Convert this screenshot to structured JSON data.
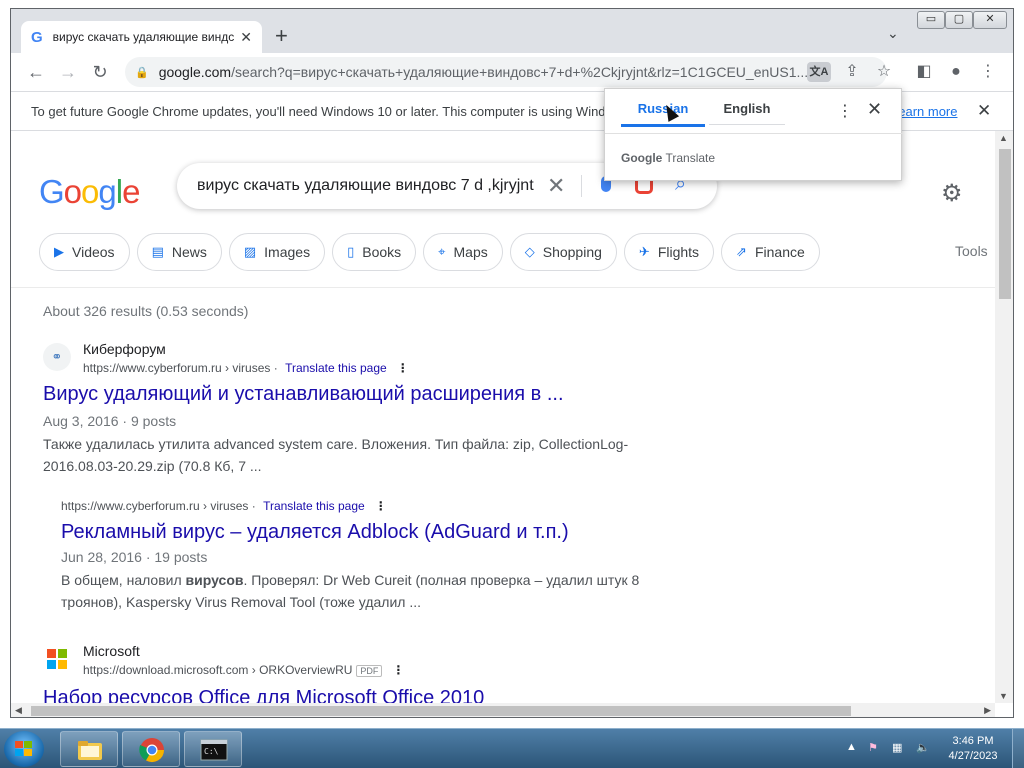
{
  "browser": {
    "tab_title": "вирус скачать удаляющие виндс",
    "tab_close": "✕",
    "new_tab": "+",
    "url_domain": "google.com",
    "url_path": "/search?q=вирус+скачать+удаляющие+виндовс+7+d+%2Ckjryjnt&rlz=1C1GCEU_enUS1...",
    "window_controls": [
      "▭",
      "▢",
      "✕"
    ]
  },
  "infobar": {
    "message": "To get future Google Chrome updates, you'll need Windows 10 or later. This computer is using Windows 7.",
    "learn_more": "Learn more"
  },
  "search": {
    "logo": [
      "G",
      "o",
      "o",
      "g",
      "l",
      "e"
    ],
    "query": "вирус скачать удаляющие виндовс 7 d ,kjryjnt",
    "chips": [
      {
        "icon": "▶",
        "label": "Videos"
      },
      {
        "icon": "▤",
        "label": "News"
      },
      {
        "icon": "▨",
        "label": "Images"
      },
      {
        "icon": "▯",
        "label": "Books"
      },
      {
        "icon": "⌖",
        "label": "Maps"
      },
      {
        "icon": "◇",
        "label": "Shopping"
      },
      {
        "icon": "✈",
        "label": "Flights"
      },
      {
        "icon": "⇗",
        "label": "Finance"
      }
    ],
    "tools": "Tools",
    "stats": "About 326 results (0.53 seconds)"
  },
  "results": [
    {
      "site": "Киберфорум",
      "url": "https://www.cyberforum.ru › viruses",
      "translate": "Translate this page",
      "title": "Вирус удаляющий и устанавливающий расширения в ...",
      "date": "Aug 3, 2016 · 9 posts",
      "snippet": "Также удалилась утилита advanced system care. Вложения. Тип файла: zip, CollectionLog-2016.08.03-20.29.zip (70.8 Кб, 7 ..."
    },
    {
      "url": "https://www.cyberforum.ru › viruses",
      "translate": "Translate this page",
      "title": "Рекламный вирус – удаляется Adblock (AdGuard и т.п.)",
      "date": "Jun 28, 2016 · 19 posts",
      "snippet_pre": "В общем, наловил ",
      "snippet_bold": "вирусов",
      "snippet_post": ". Проверял: Dr Web Cureit (полная проверка – удалил штук 8 троянов), Kaspersky Virus Removal Tool (тоже удалил ..."
    },
    {
      "site": "Microsoft",
      "url": "https://download.microsoft.com › ORKOverviewRU",
      "badge": "PDF",
      "title": "Набор ресурсов Office для Microsoft Office 2010"
    }
  ],
  "translate_popup": {
    "source_lang": "Russian",
    "target_lang": "English",
    "brand_google": "Google",
    "brand_translate": " Translate"
  },
  "taskbar": {
    "time": "3:46 PM",
    "date": "4/27/2023"
  },
  "colors": {
    "link": "#1a0dab",
    "accent": "#1a73e8",
    "taskbar": "#2c5577"
  }
}
